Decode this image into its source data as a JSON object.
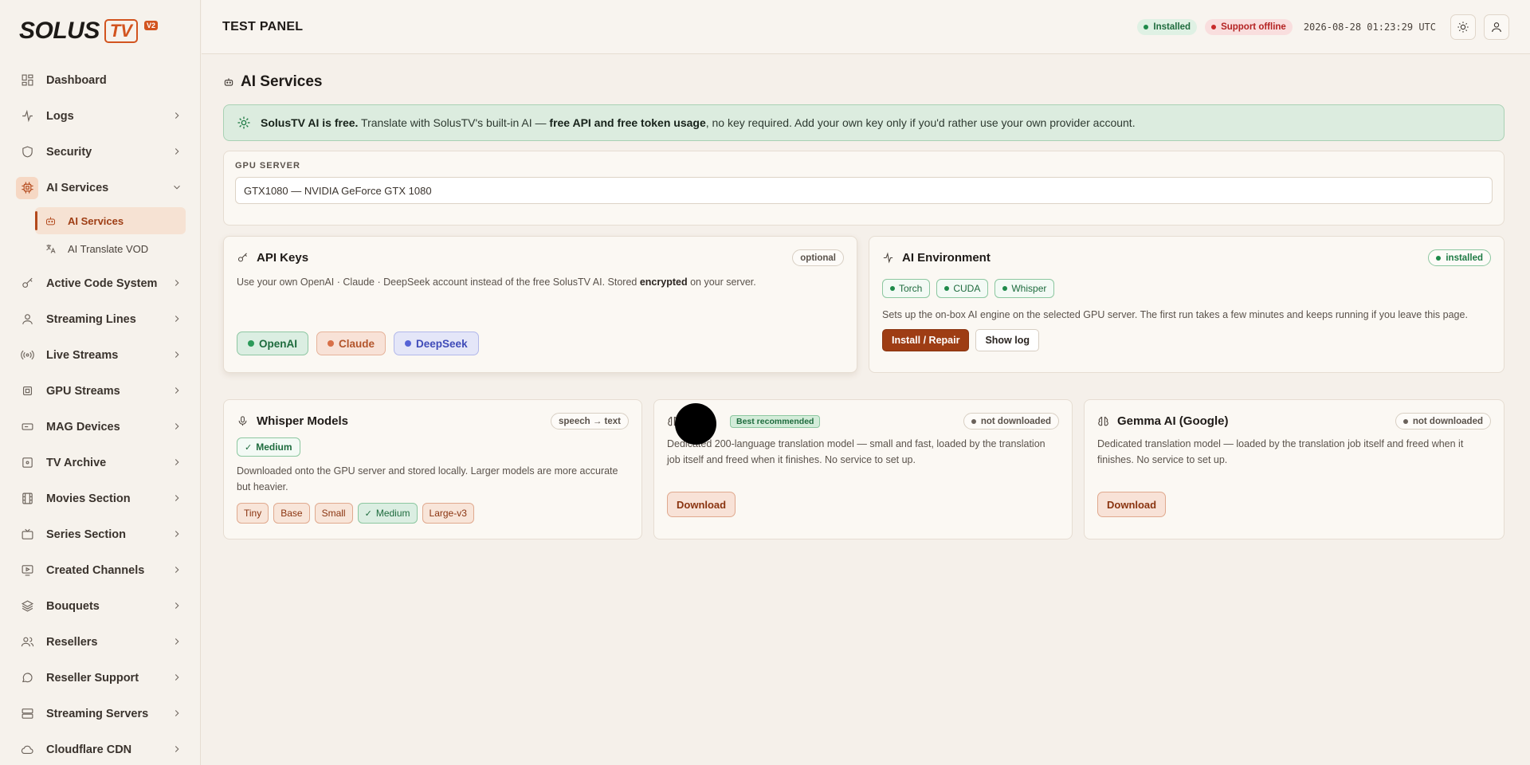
{
  "brand": {
    "name": "SOLUS",
    "tv": "TV",
    "version": "V2"
  },
  "sidebar": {
    "items": [
      {
        "label": "Dashboard",
        "icon": "dashboard-icon",
        "chevron": false
      },
      {
        "label": "Logs",
        "icon": "activity-icon",
        "chevron": true
      },
      {
        "label": "Security",
        "icon": "shield-icon",
        "chevron": true
      },
      {
        "label": "AI Services",
        "icon": "cpu-icon",
        "chevron": true,
        "expanded": true
      },
      {
        "label": "Active Code System",
        "icon": "key-icon",
        "chevron": true
      },
      {
        "label": "Streaming Lines",
        "icon": "user-icon",
        "chevron": true
      },
      {
        "label": "Live Streams",
        "icon": "broadcast-icon",
        "chevron": true
      },
      {
        "label": "GPU Streams",
        "icon": "chip-icon",
        "chevron": true
      },
      {
        "label": "MAG Devices",
        "icon": "device-icon",
        "chevron": true
      },
      {
        "label": "TV Archive",
        "icon": "archive-icon",
        "chevron": true
      },
      {
        "label": "Movies Section",
        "icon": "film-icon",
        "chevron": true
      },
      {
        "label": "Series Section",
        "icon": "tv-icon",
        "chevron": true
      },
      {
        "label": "Created Channels",
        "icon": "play-screen-icon",
        "chevron": true
      },
      {
        "label": "Bouquets",
        "icon": "layers-icon",
        "chevron": true
      },
      {
        "label": "Resellers",
        "icon": "users-icon",
        "chevron": true
      },
      {
        "label": "Reseller Support",
        "icon": "chat-icon",
        "chevron": true
      },
      {
        "label": "Streaming Servers",
        "icon": "server-icon",
        "chevron": true
      },
      {
        "label": "Cloudflare CDN",
        "icon": "cloud-icon",
        "chevron": true
      }
    ],
    "subitems": [
      {
        "label": "AI Services",
        "icon": "robot-icon",
        "active": true
      },
      {
        "label": "AI Translate VOD",
        "icon": "translate-icon",
        "active": false
      }
    ]
  },
  "topbar": {
    "title": "TEST PANEL",
    "status_installed": "Installed",
    "status_support": "Support offline",
    "clock": "2026-08-28 01:23:29 UTC"
  },
  "page": {
    "title": "AI Services"
  },
  "banner": {
    "strong1": "SolusTV AI is free.",
    "text1": " Translate with SolusTV's built-in AI — ",
    "strong2": "free API and free token usage",
    "text2": ", no key required. Add your own key only if you'd rather use your own provider account."
  },
  "gpu": {
    "label": "GPU SERVER",
    "value": "GTX1080 — NVIDIA GeForce GTX 1080"
  },
  "api_keys": {
    "title": "API Keys",
    "tag": "optional",
    "desc_pre": "Use your own OpenAI · Claude · DeepSeek account instead of the free SolusTV AI. Stored ",
    "desc_bold": "encrypted",
    "desc_post": " on your server.",
    "providers": [
      "OpenAI",
      "Claude",
      "DeepSeek"
    ]
  },
  "ai_env": {
    "title": "AI Environment",
    "tag": "installed",
    "components": [
      "Torch",
      "CUDA",
      "Whisper"
    ],
    "desc": "Sets up the on-box AI engine on the selected GPU server. The first run takes a few minutes and keeps running if you leave this page.",
    "install_label": "Install / Repair",
    "log_label": "Show log"
  },
  "whisper": {
    "title": "Whisper Models",
    "tag": "speech → text",
    "current": "Medium",
    "desc": "Downloaded onto the GPU server and stored locally. Larger models are more accurate but heavier.",
    "sizes": [
      "Tiny",
      "Base",
      "Small",
      "Medium",
      "Large-v3"
    ],
    "selected": "Medium"
  },
  "nllb": {
    "recommended": "Best recommended",
    "tag": "not downloaded",
    "desc": "Dedicated 200-language translation model — small and fast, loaded by the translation job itself and freed when it finishes. No service to set up.",
    "download_label": "Download"
  },
  "gemma": {
    "title": "Gemma AI (Google)",
    "tag": "not downloaded",
    "desc": "Dedicated translation model — loaded by the translation job itself and freed when it finishes. No service to set up.",
    "download_label": "Download"
  }
}
